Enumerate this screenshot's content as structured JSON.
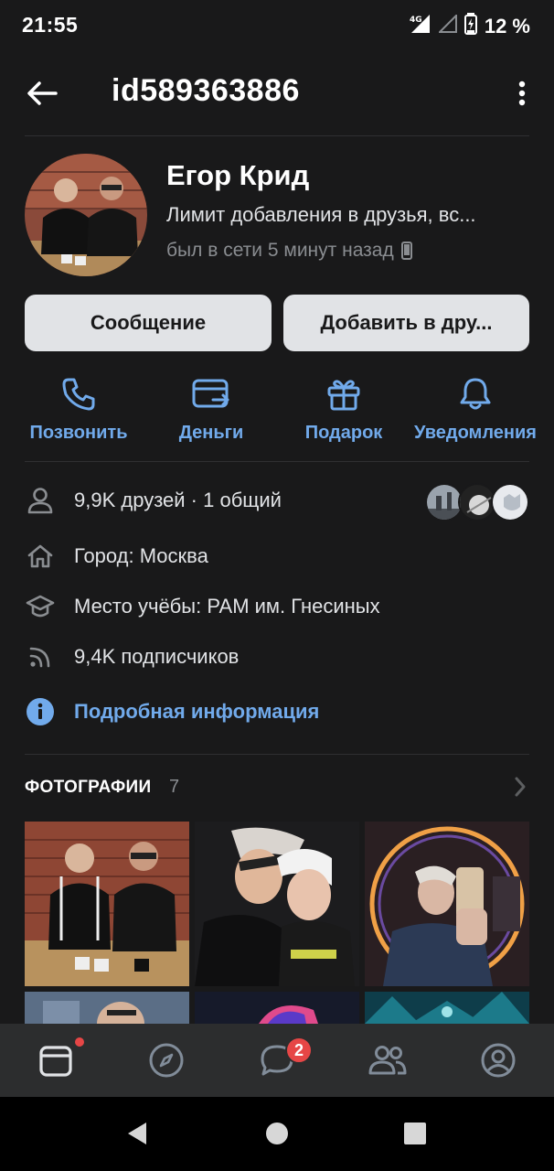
{
  "status_bar": {
    "time": "21:55",
    "network": "4G",
    "battery": "12 %"
  },
  "header": {
    "title": "id589363886",
    "back_icon": "arrow-left-icon",
    "more_icon": "more-vertical-icon"
  },
  "profile": {
    "name": "Егор Крид",
    "status": "Лимит добавления в друзья, вс...",
    "online": "был в сети 5 минут назад",
    "online_device_icon": "phone-icon"
  },
  "buttons": {
    "message": "Сообщение",
    "add_friend": "Добавить в дру..."
  },
  "actions": [
    {
      "label": "Позвонить",
      "icon": "phone-call-icon"
    },
    {
      "label": "Деньги",
      "icon": "money-transfer-icon"
    },
    {
      "label": "Подарок",
      "icon": "gift-icon"
    },
    {
      "label": "Уведомления",
      "icon": "bell-icon"
    }
  ],
  "info": {
    "friends": "9,9K друзей · 1 общий",
    "city": "Город: Москва",
    "education": "Место учёбы: РАМ им. Гнесиных",
    "followers": "9,4K подписчиков",
    "details": "Подробная информация"
  },
  "photos": {
    "title": "ФОТОГРАФИИ",
    "count": "7"
  },
  "tabbar": {
    "messages_badge": "2"
  },
  "colors": {
    "background": "#19191a",
    "accent": "#71aaeb",
    "button_bg": "#e1e3e6",
    "badge": "#e64646",
    "tabbar": "#2c2d2e"
  }
}
